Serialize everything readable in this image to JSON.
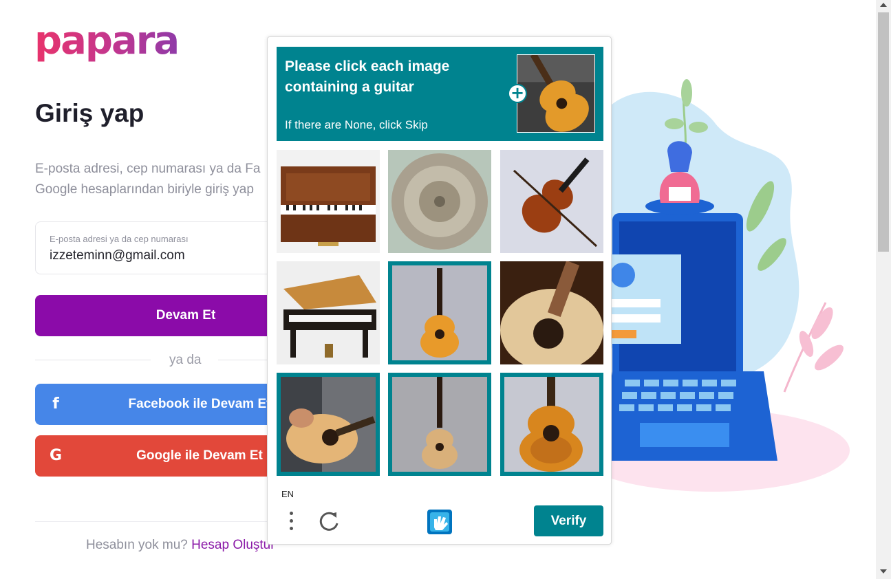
{
  "brand": {
    "logo_text": "papara",
    "primary_color": "#8b0ba9",
    "facebook_color": "#4686e8",
    "google_color": "#e2483a",
    "captcha_color": "#00838f"
  },
  "login": {
    "title": "Giriş yap",
    "subtitle_line1": "E-posta adresi, cep numarası ya da Fa",
    "subtitle_line2": "Google hesaplarından biriyle giriş yap",
    "email_label": "E-posta adresi ya da cep numarası",
    "email_value": "izzeteminn@gmail.com",
    "continue_label": "Devam Et",
    "divider_text": "ya da",
    "facebook_label": "Facebook ile Devam Et",
    "facebook_icon": "f",
    "google_label": "Google ile Devam Et",
    "google_icon": "G",
    "signup_question": "Hesabın yok mu?",
    "signup_link": "Hesap Oluştur"
  },
  "captcha": {
    "prompt": "Please click each image containing a guitar",
    "hint": "If there are None, click Skip",
    "plus_icon": "+",
    "tiles": [
      {
        "subject": "upright-piano",
        "selected": false
      },
      {
        "subject": "gong",
        "selected": false
      },
      {
        "subject": "violin",
        "selected": false
      },
      {
        "subject": "grand-piano",
        "selected": false
      },
      {
        "subject": "guitar",
        "selected": true
      },
      {
        "subject": "guitar-closeup",
        "selected": false
      },
      {
        "subject": "person-playing-guitar",
        "selected": true
      },
      {
        "subject": "guitar",
        "selected": true
      },
      {
        "subject": "guitar",
        "selected": true
      }
    ],
    "language": "EN",
    "verify_label": "Verify"
  }
}
